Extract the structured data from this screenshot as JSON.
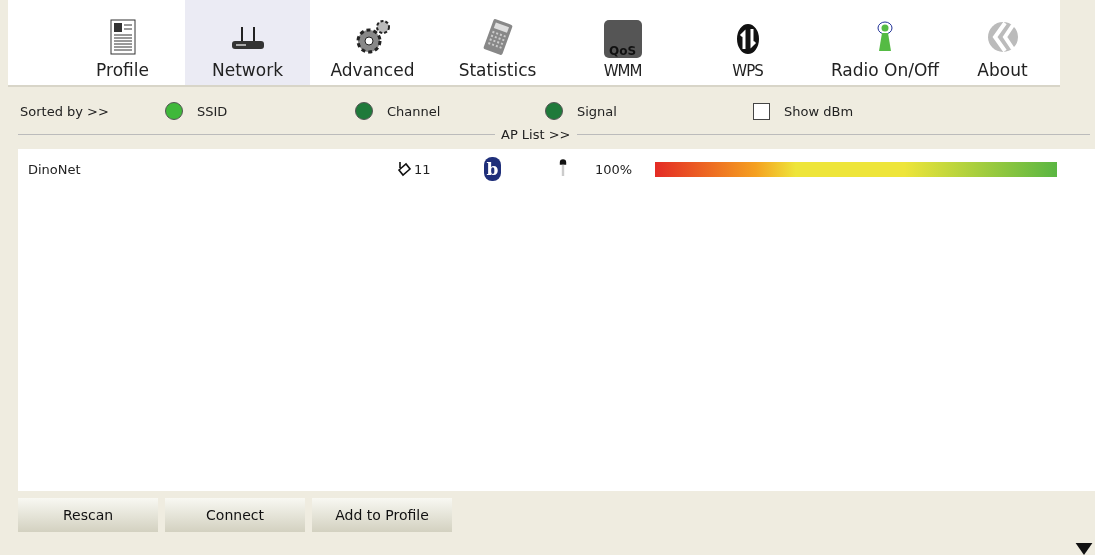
{
  "tabs": [
    {
      "label": "Profile",
      "kind": "profile",
      "selected": false
    },
    {
      "label": "Network",
      "kind": "network",
      "selected": true
    },
    {
      "label": "Advanced",
      "kind": "advanced",
      "selected": false
    },
    {
      "label": "Statistics",
      "kind": "statistics",
      "selected": false
    },
    {
      "label": "WMM",
      "kind": "wmm",
      "icon_text": "QoS",
      "selected": false
    },
    {
      "label": "WPS",
      "kind": "wps",
      "selected": false
    },
    {
      "label": "Radio On/Off",
      "kind": "radio",
      "selected": false
    },
    {
      "label": "About",
      "kind": "about",
      "selected": false
    }
  ],
  "sort": {
    "label": "Sorted by >>",
    "options": [
      {
        "label": "SSID",
        "selected": true
      },
      {
        "label": "Channel",
        "selected": false
      },
      {
        "label": "Signal",
        "selected": false
      }
    ],
    "show_dbm": {
      "label": "Show dBm",
      "checked": false
    }
  },
  "ap_list": {
    "title": "AP List >>",
    "rows": [
      {
        "ssid": "DinoNet",
        "channel": "11",
        "mode": "b",
        "encrypted": true,
        "signal": "100%",
        "level": 1.0
      }
    ]
  },
  "buttons": [
    "Rescan",
    "Connect",
    "Add to Profile"
  ]
}
